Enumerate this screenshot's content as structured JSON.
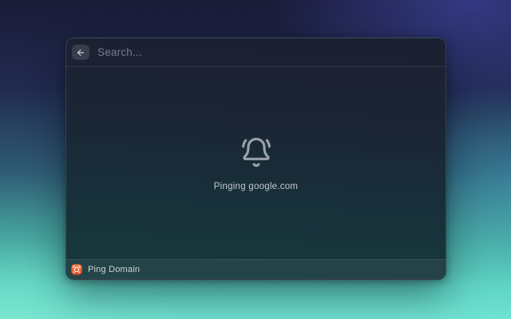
{
  "search": {
    "placeholder": "Search..."
  },
  "content": {
    "status_message": "Pinging google.com",
    "icon": "bell-ring-icon"
  },
  "footer": {
    "command_label": "Ping Domain",
    "command_icon": "ping-domain-icon"
  },
  "colors": {
    "command_icon_orange": "#ed5a2d",
    "bell_icon_gray": "#9aa2a9",
    "bg_top_left": "#191b37",
    "bg_top_right": "#2e3470",
    "bg_bottom_left": "#6fd8c3",
    "bg_bottom_right": "#55e0d0",
    "window_top": "#1c2032",
    "window_bottom": "#163a3d"
  }
}
